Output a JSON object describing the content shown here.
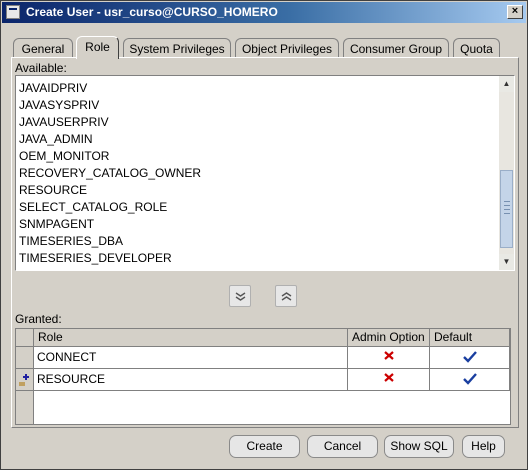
{
  "window": {
    "title": "Create User - usr_curso@CURSO_HOMERO",
    "close_label": "×"
  },
  "tabs": [
    {
      "label": "General"
    },
    {
      "label": "Role"
    },
    {
      "label": "System Privileges"
    },
    {
      "label": "Object Privileges"
    },
    {
      "label": "Consumer Group"
    },
    {
      "label": "Quota"
    }
  ],
  "active_tab": "Role",
  "available": {
    "label": "Available:",
    "items": [
      "JAVAIDPRIV",
      "JAVASYSPRIV",
      "JAVAUSERPRIV",
      "JAVA_ADMIN",
      "OEM_MONITOR",
      "RECOVERY_CATALOG_OWNER",
      "RESOURCE",
      "SELECT_CATALOG_ROLE",
      "SNMPAGENT",
      "TIMESERIES_DBA",
      "TIMESERIES_DEVELOPER"
    ]
  },
  "granted": {
    "label": "Granted:",
    "columns": {
      "role": "Role",
      "admin": "Admin Option",
      "default": "Default"
    },
    "rows": [
      {
        "role": "CONNECT",
        "admin_option": false,
        "default": true
      },
      {
        "role": "RESOURCE",
        "admin_option": false,
        "default": true
      }
    ]
  },
  "buttons": {
    "create": "Create",
    "cancel": "Cancel",
    "show_sql": "Show SQL",
    "help": "Help"
  },
  "colors": {
    "title_start": "#0a246a",
    "title_end": "#a6caf0",
    "x_mark": "#cc0000",
    "check_mark": "#1a3fa0"
  }
}
